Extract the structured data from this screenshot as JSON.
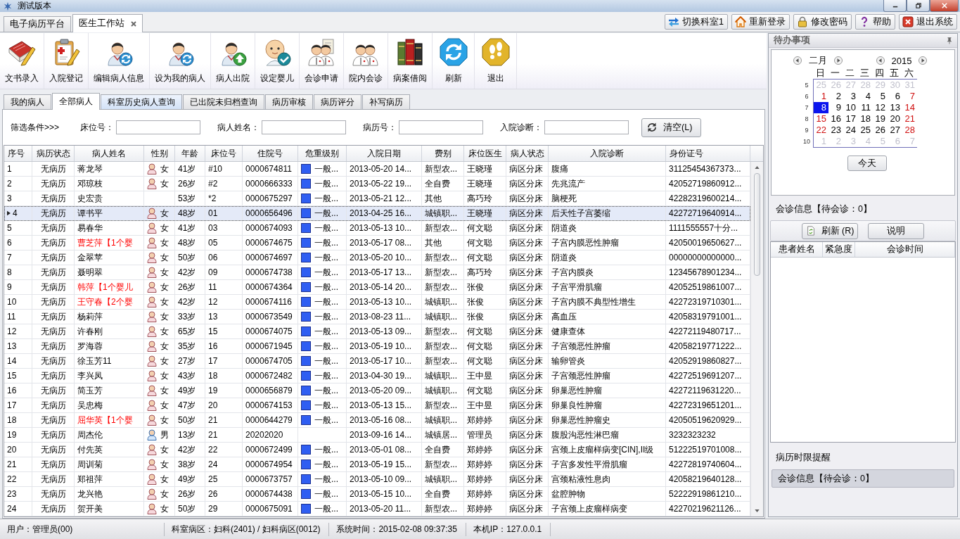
{
  "window": {
    "title": "测试版本"
  },
  "main_tabs": [
    {
      "label": "电子病历平台",
      "selected": false,
      "closable": false
    },
    {
      "label": "医生工作站",
      "selected": true,
      "closable": true
    }
  ],
  "top_buttons": [
    {
      "label": "切换科室1",
      "kind": "switch"
    },
    {
      "label": "重新登录",
      "kind": "home"
    },
    {
      "label": "修改密码",
      "kind": "lock"
    },
    {
      "label": "帮助",
      "kind": "help"
    },
    {
      "label": "退出系统",
      "kind": "exit"
    }
  ],
  "toolbar": [
    {
      "label": "文书录入",
      "kind": "book"
    },
    {
      "label": "入院登记",
      "kind": "clipboard"
    },
    {
      "label": "编辑病人信息",
      "kind": "person_refresh"
    },
    {
      "label": "设为我的病人",
      "kind": "person_refresh"
    },
    {
      "label": "病人出院",
      "kind": "person_badge"
    },
    {
      "label": "设定婴儿",
      "kind": "baby"
    },
    {
      "label": "会诊申请",
      "kind": "consult_request"
    },
    {
      "label": "院内会诊",
      "kind": "consult"
    },
    {
      "label": "病案借阅",
      "kind": "books"
    },
    {
      "label": "刷新",
      "kind": "refresh"
    },
    {
      "label": "退出",
      "kind": "exit"
    }
  ],
  "sub_tabs": [
    {
      "label": "我的病人",
      "selected": false,
      "hovered": false
    },
    {
      "label": "全部病人",
      "selected": true,
      "hovered": false
    },
    {
      "label": "科室历史病人查询",
      "selected": false,
      "hovered": true
    },
    {
      "label": "已出院未归档查询",
      "selected": false,
      "hovered": false
    },
    {
      "label": "病历审核",
      "selected": false,
      "hovered": false
    },
    {
      "label": "病历评分",
      "selected": false,
      "hovered": false
    },
    {
      "label": "补写病历",
      "selected": false,
      "hovered": false
    }
  ],
  "filters": {
    "title": "筛选条件>>>",
    "fields": [
      {
        "label": "床位号："
      },
      {
        "label": "病人姓名："
      },
      {
        "label": "病历号："
      },
      {
        "label": "入院诊断："
      }
    ],
    "clear_button": "清空(L)"
  },
  "table": {
    "columns": [
      "序号",
      "病历状态",
      "病人姓名",
      "性别",
      "年龄",
      "床位号",
      "住院号",
      "危重级别",
      "入院日期",
      "费别",
      "床位医生",
      "病人状态",
      "入院诊断",
      "身份证号"
    ],
    "rows": [
      {
        "no": "1",
        "record_status": "无病历",
        "name": "蒋龙琴",
        "with_baby": false,
        "gender": {
          "kind": "female",
          "label": "女"
        },
        "age": "41岁",
        "bed": "#10",
        "admission_no": "0000674811",
        "severity": "一般...",
        "admit_date": "2013-05-20 14...",
        "fee_type": "新型农...",
        "doctor": "王晓瑾",
        "patient_status": "病区分床",
        "diagnosis": "腹痛",
        "id_number": "31125454367373...",
        "selected": false
      },
      {
        "no": "2",
        "record_status": "无病历",
        "name": "邓琼枝",
        "with_baby": false,
        "gender": {
          "kind": "female",
          "label": "女"
        },
        "age": "26岁",
        "bed": "#2",
        "admission_no": "0000666333",
        "severity": "一般...",
        "admit_date": "2013-05-22 19...",
        "fee_type": "全自费",
        "doctor": "王晓瑾",
        "patient_status": "病区分床",
        "diagnosis": "先兆流产",
        "id_number": "42052719860912...",
        "selected": false
      },
      {
        "no": "3",
        "record_status": "无病历",
        "name": "史宏贵",
        "with_baby": false,
        "age": "53岁",
        "bed": "*2",
        "admission_no": "0000675297",
        "severity": "一般...",
        "admit_date": "2013-05-21 12...",
        "fee_type": "其他",
        "doctor": "高巧玲",
        "patient_status": "病区分床",
        "diagnosis": "脑梗死",
        "id_number": "42282319600214...",
        "selected": false
      },
      {
        "no": "4",
        "record_status": "无病历",
        "name": "谭书平",
        "with_baby": false,
        "gender": {
          "kind": "female",
          "label": "女"
        },
        "age": "48岁",
        "bed": "01",
        "admission_no": "0000656496",
        "severity": "一般...",
        "admit_date": "2013-04-25 16...",
        "fee_type": "城镇职...",
        "doctor": "王晓瑾",
        "patient_status": "病区分床",
        "diagnosis": "后天性子宫萎缩",
        "id_number": "42272719640914...",
        "selected": true
      },
      {
        "no": "5",
        "record_status": "无病历",
        "name": "易春华",
        "with_baby": false,
        "gender": {
          "kind": "female",
          "label": "女"
        },
        "age": "41岁",
        "bed": "03",
        "admission_no": "0000674093",
        "severity": "一般...",
        "admit_date": "2013-05-13 10...",
        "fee_type": "新型农...",
        "doctor": "何文聪",
        "patient_status": "病区分床",
        "diagnosis": "阴道炎",
        "id_number": "1111555557十分...",
        "selected": false
      },
      {
        "no": "6",
        "record_status": "无病历",
        "name": "曹芝萍【1个婴",
        "with_baby": true,
        "gender": {
          "kind": "female",
          "label": "女"
        },
        "age": "48岁",
        "bed": "05",
        "admission_no": "0000674675",
        "severity": "一般...",
        "admit_date": "2013-05-17 08...",
        "fee_type": "其他",
        "doctor": "何文聪",
        "patient_status": "病区分床",
        "diagnosis": "子宫内膜恶性肿瘤",
        "id_number": "42050019650627...",
        "selected": false
      },
      {
        "no": "7",
        "record_status": "无病历",
        "name": "金翠苹",
        "with_baby": false,
        "gender": {
          "kind": "female",
          "label": "女"
        },
        "age": "50岁",
        "bed": "06",
        "admission_no": "0000674697",
        "severity": "一般...",
        "admit_date": "2013-05-20 10...",
        "fee_type": "新型农...",
        "doctor": "何文聪",
        "patient_status": "病区分床",
        "diagnosis": "阴道炎",
        "id_number": "00000000000000...",
        "selected": false
      },
      {
        "no": "8",
        "record_status": "无病历",
        "name": "聂明翠",
        "with_baby": false,
        "gender": {
          "kind": "female",
          "label": "女"
        },
        "age": "42岁",
        "bed": "09",
        "admission_no": "0000674738",
        "severity": "一般...",
        "admit_date": "2013-05-17 13...",
        "fee_type": "新型农...",
        "doctor": "高巧玲",
        "patient_status": "病区分床",
        "diagnosis": "子宫内膜炎",
        "id_number": "12345678901234...",
        "selected": false
      },
      {
        "no": "9",
        "record_status": "无病历",
        "name": "韩萍【1个婴儿",
        "with_baby": true,
        "gender": {
          "kind": "female",
          "label": "女"
        },
        "age": "26岁",
        "bed": "11",
        "admission_no": "0000674364",
        "severity": "一般...",
        "admit_date": "2013-05-14 20...",
        "fee_type": "新型农...",
        "doctor": "张俊",
        "patient_status": "病区分床",
        "diagnosis": "子宫平滑肌瘤",
        "id_number": "42052519861007...",
        "selected": false
      },
      {
        "no": "10",
        "record_status": "无病历",
        "name": "王守春【2个婴",
        "with_baby": true,
        "gender": {
          "kind": "female",
          "label": "女"
        },
        "age": "42岁",
        "bed": "12",
        "admission_no": "0000674116",
        "severity": "一般...",
        "admit_date": "2013-05-13 10...",
        "fee_type": "城镇职...",
        "doctor": "张俊",
        "patient_status": "病区分床",
        "diagnosis": "子宫内膜不典型性增生",
        "id_number": "42272319710301...",
        "selected": false
      },
      {
        "no": "11",
        "record_status": "无病历",
        "name": "杨莉萍",
        "with_baby": false,
        "gender": {
          "kind": "female",
          "label": "女"
        },
        "age": "33岁",
        "bed": "13",
        "admission_no": "0000673549",
        "severity": "一般...",
        "admit_date": "2013-08-23 11...",
        "fee_type": "城镇职...",
        "doctor": "张俊",
        "patient_status": "病区分床",
        "diagnosis": "高血压",
        "id_number": "42058319791001...",
        "selected": false
      },
      {
        "no": "12",
        "record_status": "无病历",
        "name": "许春刚",
        "with_baby": false,
        "gender": {
          "kind": "female",
          "label": "女"
        },
        "age": "65岁",
        "bed": "15",
        "admission_no": "0000674075",
        "severity": "一般...",
        "admit_date": "2013-05-13 09...",
        "fee_type": "新型农...",
        "doctor": "何文聪",
        "patient_status": "病区分床",
        "diagnosis": "健康查体",
        "id_number": "42272119480717...",
        "selected": false
      },
      {
        "no": "13",
        "record_status": "无病历",
        "name": "罗海蓉",
        "with_baby": false,
        "gender": {
          "kind": "female",
          "label": "女"
        },
        "age": "35岁",
        "bed": "16",
        "admission_no": "0000671945",
        "severity": "一般...",
        "admit_date": "2013-05-19 10...",
        "fee_type": "新型农...",
        "doctor": "何文聪",
        "patient_status": "病区分床",
        "diagnosis": "子宫颈恶性肿瘤",
        "id_number": "42058219771222...",
        "selected": false
      },
      {
        "no": "14",
        "record_status": "无病历",
        "name": "徐玉芳11",
        "with_baby": false,
        "gender": {
          "kind": "female",
          "label": "女"
        },
        "age": "27岁",
        "bed": "17",
        "admission_no": "0000674705",
        "severity": "一般...",
        "admit_date": "2013-05-17 10...",
        "fee_type": "新型农...",
        "doctor": "何文聪",
        "patient_status": "病区分床",
        "diagnosis": "输卵管炎",
        "id_number": "42052919860827...",
        "selected": false
      },
      {
        "no": "15",
        "record_status": "无病历",
        "name": "李兴凤",
        "with_baby": false,
        "gender": {
          "kind": "female",
          "label": "女"
        },
        "age": "43岁",
        "bed": "18",
        "admission_no": "0000672482",
        "severity": "一般...",
        "admit_date": "2013-04-30 19...",
        "fee_type": "城镇职...",
        "doctor": "王中昱",
        "patient_status": "病区分床",
        "diagnosis": "子宫颈恶性肿瘤",
        "id_number": "42272519691207...",
        "selected": false
      },
      {
        "no": "16",
        "record_status": "无病历",
        "name": "简玉芳",
        "with_baby": false,
        "gender": {
          "kind": "female",
          "label": "女"
        },
        "age": "49岁",
        "bed": "19",
        "admission_no": "0000656879",
        "severity": "一般...",
        "admit_date": "2013-05-20 09...",
        "fee_type": "城镇职...",
        "doctor": "何文聪",
        "patient_status": "病区分床",
        "diagnosis": "卵巢恶性肿瘤",
        "id_number": "42272119631220...",
        "selected": false
      },
      {
        "no": "17",
        "record_status": "无病历",
        "name": "吴忠梅",
        "with_baby": false,
        "gender": {
          "kind": "female",
          "label": "女"
        },
        "age": "47岁",
        "bed": "20",
        "admission_no": "0000674153",
        "severity": "一般...",
        "admit_date": "2013-05-13 15...",
        "fee_type": "新型农...",
        "doctor": "王中昱",
        "patient_status": "病区分床",
        "diagnosis": "卵巢良性肿瘤",
        "id_number": "42272319651201...",
        "selected": false
      },
      {
        "no": "18",
        "record_status": "无病历",
        "name": "屈华英【1个婴",
        "with_baby": true,
        "gender": {
          "kind": "female",
          "label": "女"
        },
        "age": "50岁",
        "bed": "21",
        "admission_no": "0000644279",
        "severity": "一般...",
        "admit_date": "2013-05-16 08...",
        "fee_type": "城镇职...",
        "doctor": "郑婷婷",
        "patient_status": "病区分床",
        "diagnosis": "卵巢恶性肿瘤史",
        "id_number": "42050519620929...",
        "selected": false
      },
      {
        "no": "19",
        "record_status": "无病历",
        "name": "周杰伦",
        "with_baby": false,
        "gender": {
          "kind": "male",
          "label": "男"
        },
        "age": "13岁",
        "bed": "21",
        "admission_no": "20202020",
        "admit_date": "2013-09-16 14...",
        "fee_type": "城镇居...",
        "doctor": "管理员",
        "patient_status": "病区分床",
        "diagnosis": "腹股沟恶性淋巴瘤",
        "id_number": "3232323232",
        "selected": false
      },
      {
        "no": "20",
        "record_status": "无病历",
        "name": "付先英",
        "with_baby": false,
        "gender": {
          "kind": "female",
          "label": "女"
        },
        "age": "42岁",
        "bed": "22",
        "admission_no": "0000672499",
        "severity": "一般...",
        "admit_date": "2013-05-01 08...",
        "fee_type": "全自费",
        "doctor": "郑婷婷",
        "patient_status": "病区分床",
        "diagnosis": "宫颈上皮瘤样病变[CIN],II级",
        "id_number": "51222519701008...",
        "selected": false
      },
      {
        "no": "21",
        "record_status": "无病历",
        "name": "周训菊",
        "with_baby": false,
        "gender": {
          "kind": "female",
          "label": "女"
        },
        "age": "38岁",
        "bed": "24",
        "admission_no": "0000674954",
        "severity": "一般...",
        "admit_date": "2013-05-19 15...",
        "fee_type": "新型农...",
        "doctor": "郑婷婷",
        "patient_status": "病区分床",
        "diagnosis": "子宫多发性平滑肌瘤",
        "id_number": "42272819740604...",
        "selected": false
      },
      {
        "no": "22",
        "record_status": "无病历",
        "name": "郑祖萍",
        "with_baby": false,
        "gender": {
          "kind": "female",
          "label": "女"
        },
        "age": "49岁",
        "bed": "25",
        "admission_no": "0000673757",
        "severity": "一般...",
        "admit_date": "2013-05-10 09...",
        "fee_type": "城镇职...",
        "doctor": "郑婷婷",
        "patient_status": "病区分床",
        "diagnosis": "宫颈粘液性息肉",
        "id_number": "42058219640128...",
        "selected": false
      },
      {
        "no": "23",
        "record_status": "无病历",
        "name": "龙兴艳",
        "with_baby": false,
        "gender": {
          "kind": "female",
          "label": "女"
        },
        "age": "26岁",
        "bed": "26",
        "admission_no": "0000674438",
        "severity": "一般...",
        "admit_date": "2013-05-15 10...",
        "fee_type": "全自费",
        "doctor": "郑婷婷",
        "patient_status": "病区分床",
        "diagnosis": "盆腔肿物",
        "id_number": "52222919861210...",
        "selected": false
      },
      {
        "no": "24",
        "record_status": "无病历",
        "name": "贺开美",
        "with_baby": false,
        "gender": {
          "kind": "female",
          "label": "女"
        },
        "age": "50岁",
        "bed": "29",
        "admission_no": "0000675091",
        "severity": "一般...",
        "admit_date": "2013-05-20 11...",
        "fee_type": "新型农...",
        "doctor": "郑婷婷",
        "patient_status": "病区分床",
        "diagnosis": "子宫颈上皮瘤样病变",
        "id_number": "42270219621126...",
        "selected": false
      }
    ]
  },
  "todo_panel": {
    "title": "待办事项",
    "calendar": {
      "month": "二月",
      "year": "2015",
      "weekdays": [
        "日",
        "一",
        "二",
        "三",
        "四",
        "五",
        "六"
      ],
      "weeks": [
        {
          "number": "5",
          "days": [
            {
              "label": "25",
              "kind": "other",
              "selected": false
            },
            {
              "label": "26",
              "kind": "other",
              "selected": false
            },
            {
              "label": "27",
              "kind": "other",
              "selected": false
            },
            {
              "label": "28",
              "kind": "other",
              "selected": false
            },
            {
              "label": "29",
              "kind": "other",
              "selected": false
            },
            {
              "label": "30",
              "kind": "other",
              "selected": false
            },
            {
              "label": "31",
              "kind": "other",
              "selected": false
            }
          ]
        },
        {
          "number": "6",
          "days": [
            {
              "label": "1",
              "kind": "weekend",
              "selected": false
            },
            {
              "label": "2",
              "kind": "weekday",
              "selected": false
            },
            {
              "label": "3",
              "kind": "weekday",
              "selected": false
            },
            {
              "label": "4",
              "kind": "weekday",
              "selected": false
            },
            {
              "label": "5",
              "kind": "weekday",
              "selected": false
            },
            {
              "label": "6",
              "kind": "weekday",
              "selected": false
            },
            {
              "label": "7",
              "kind": "weekend",
              "selected": false
            }
          ]
        },
        {
          "number": "7",
          "days": [
            {
              "label": "8",
              "kind": "weekend",
              "selected": true
            },
            {
              "label": "9",
              "kind": "weekday",
              "selected": false
            },
            {
              "label": "10",
              "kind": "weekday",
              "selected": false
            },
            {
              "label": "11",
              "kind": "weekday",
              "selected": false
            },
            {
              "label": "12",
              "kind": "weekday",
              "selected": false
            },
            {
              "label": "13",
              "kind": "weekday",
              "selected": false
            },
            {
              "label": "14",
              "kind": "weekend",
              "selected": false
            }
          ]
        },
        {
          "number": "8",
          "days": [
            {
              "label": "15",
              "kind": "weekend",
              "selected": false
            },
            {
              "label": "16",
              "kind": "weekday",
              "selected": false
            },
            {
              "label": "17",
              "kind": "weekday",
              "selected": false
            },
            {
              "label": "18",
              "kind": "weekday",
              "selected": false
            },
            {
              "label": "19",
              "kind": "weekday",
              "selected": false
            },
            {
              "label": "20",
              "kind": "weekday",
              "selected": false
            },
            {
              "label": "21",
              "kind": "weekend",
              "selected": false
            }
          ]
        },
        {
          "number": "9",
          "days": [
            {
              "label": "22",
              "kind": "weekend",
              "selected": false
            },
            {
              "label": "23",
              "kind": "weekday",
              "selected": false
            },
            {
              "label": "24",
              "kind": "weekday",
              "selected": false
            },
            {
              "label": "25",
              "kind": "weekday",
              "selected": false
            },
            {
              "label": "26",
              "kind": "weekday",
              "selected": false
            },
            {
              "label": "27",
              "kind": "weekday",
              "selected": false
            },
            {
              "label": "28",
              "kind": "weekend",
              "selected": false
            }
          ]
        },
        {
          "number": "10",
          "days": [
            {
              "label": "1",
              "kind": "other",
              "selected": false
            },
            {
              "label": "2",
              "kind": "other",
              "selected": false
            },
            {
              "label": "3",
              "kind": "other",
              "selected": false
            },
            {
              "label": "4",
              "kind": "other",
              "selected": false
            },
            {
              "label": "5",
              "kind": "other",
              "selected": false
            },
            {
              "label": "6",
              "kind": "other",
              "selected": false
            },
            {
              "label": "7",
              "kind": "other",
              "selected": false
            }
          ]
        }
      ],
      "today_button": "今天"
    },
    "consult_info": "会诊信息【待会诊：0】",
    "buttons": [
      {
        "label": "刷新 (R)",
        "kind": "refresh"
      },
      {
        "label": "说明",
        "kind": "plain"
      }
    ],
    "consult_table": {
      "columns": [
        "患者姓名",
        "紧急度",
        "会诊时间"
      ]
    },
    "reminder_title": "病历时限提醒",
    "reminder_info": "会诊信息【待会诊：0】"
  },
  "status_bar": [
    "用户：管理员(00)",
    "科室病区：妇科(2401) / 妇科病区(0012)",
    "系统时间：2015-02-08 09:37:35",
    "本机IP：127.0.0.1"
  ]
}
